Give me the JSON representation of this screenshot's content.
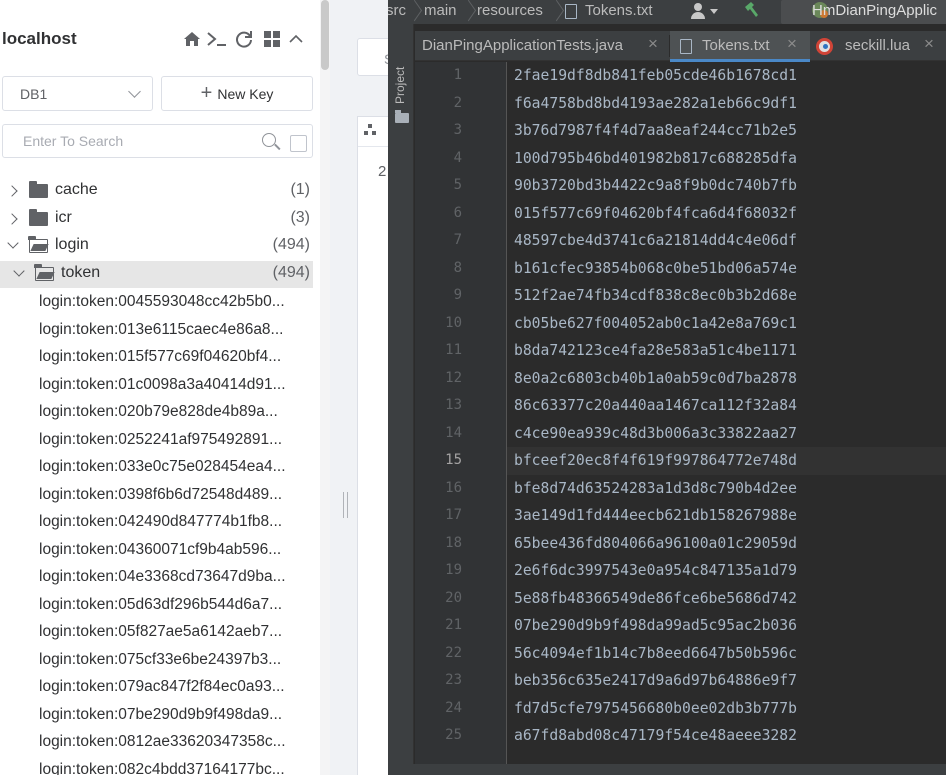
{
  "redis": {
    "connection_name": "localhost",
    "icons": [
      "home-icon",
      "terminal-icon",
      "refresh-icon",
      "grid-icon",
      "collapse-up-icon"
    ],
    "db_select": {
      "value": "DB1"
    },
    "new_key_label": "New Key",
    "search": {
      "placeholder": "Enter To Search"
    },
    "tree": [
      {
        "label": "cache",
        "count": "(1)",
        "expanded": false
      },
      {
        "label": "icr",
        "count": "(3)",
        "expanded": false
      },
      {
        "label": "login",
        "count": "(494)",
        "expanded": true
      },
      {
        "label": "token",
        "count": "(494)",
        "expanded": true,
        "selected": true
      }
    ],
    "keys": [
      "login:token:0045593048cc42b5b0...",
      "login:token:013e6115caec4e86a8...",
      "login:token:015f577c69f04620bf4...",
      "login:token:01c0098a3a40414d91...",
      "login:token:020b79e828de4b89a...",
      "login:token:0252241af975492891...",
      "login:token:033e0c75e028454ea4...",
      "login:token:0398f6b6d72548d489...",
      "login:token:042490d847774b1fb8...",
      "login:token:04360071cf9b4ab596...",
      "login:token:04e3368cd73647d9ba...",
      "login:token:05d63df296b544d6a7...",
      "login:token:05f827ae5a6142aeb7...",
      "login:token:075cf33e6be24397b3...",
      "login:token:079ac847f2f84ec0a93...",
      "login:token:07be290d9b9f498da9...",
      "login:token:0812ae33620347358c...",
      "login:token:082c4bdd37164177bc..."
    ]
  },
  "middle": {
    "tab_label": "S",
    "digit": "2"
  },
  "ide": {
    "breadcrumb": [
      "src",
      "main",
      "resources",
      "Tokens.txt"
    ],
    "run_config": "HmDianPingApplic",
    "side_tool": "Project",
    "tabs": [
      {
        "label": "DianPingApplicationTests.java",
        "active": false
      },
      {
        "label": "Tokens.txt",
        "active": true
      },
      {
        "label": "seckill.lua",
        "active": false
      }
    ],
    "current_line": 15,
    "lines": [
      "2fae19df8db841feb05cde46b1678cd1",
      "f6a4758bd8bd4193ae282a1eb66c9df1",
      "3b76d7987f4f4d7aa8eaf244cc71b2e5",
      "100d795b46bd401982b817c688285dfa",
      "90b3720bd3b4422c9a8f9b0dc740b7fb",
      "015f577c69f04620bf4fca6d4f68032f",
      "48597cbe4d3741c6a21814dd4c4e06df",
      "b161cfec93854b068c0be51bd06a574e",
      "512f2ae74fb34cdf838c8ec0b3b2d68e",
      "cb05be627f004052ab0c1a42e8a769c1",
      "b8da742123ce4fa28e583a51c4be1171",
      "8e0a2c6803cb40b1a0ab59c0d7ba2878",
      "86c63377c20a440aa1467ca112f32a84",
      "c4ce90ea939c48d3b006a3c33822aa27",
      "bfceef20ec8f4f619f997864772e748d",
      "bfe8d74d63524283a1d3d8c790b4d2ee",
      "3ae149d1fd444eecb621db158267988e",
      "65bee436fd804066a96100a01c29059d",
      "2e6f6dc3997543e0a954c847135a1d79",
      "5e88fb48366549de86fce6be5686d742",
      "07be290d9b9f498da99ad5c95ac2b036",
      "56c4094ef1b14c7b8eed6647b50b596c",
      "beb356c635e2417d9a6d97b64886e9f7",
      "fd7d5cfe7975456680b0ee02db3b777b",
      "a67fd8abd08c47179f54ce48aeee3282"
    ]
  }
}
